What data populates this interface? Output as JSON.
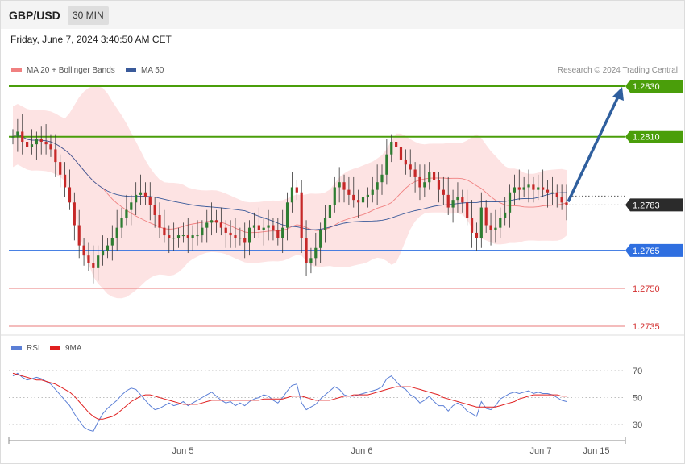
{
  "header": {
    "pair": "GBP/USD",
    "timeframe": "30 MIN",
    "datetime": "Friday, June 7, 2024 3:40:50 AM CET"
  },
  "credit": "Research © 2024 Trading Central",
  "colors": {
    "green": "#4a9e0a",
    "blue_support": "#2f6fe0",
    "red_level": "#e87a7a",
    "band_fill": "#fde3e3",
    "ma20": "#f08080",
    "ma50": "#3a5a9a",
    "arrow": "#2f5f9e",
    "candle_up": "#2e7d32",
    "candle_down": "#c62828",
    "rsi": "#5b7fd6",
    "rsi_ma": "#e02020"
  },
  "chart_data": [
    {
      "type": "candlestick",
      "legend": [
        {
          "name": "MA 20 + Bollinger Bands",
          "color": "#f08080"
        },
        {
          "name": "MA 50",
          "color": "#3a5a9a"
        }
      ],
      "ylim": [
        1.2728,
        1.2838
      ],
      "levels": [
        {
          "label": "1.2830",
          "value": 1.283,
          "style": "resistance"
        },
        {
          "label": "1.2810",
          "value": 1.281,
          "style": "resistance"
        },
        {
          "label": "1.2783",
          "value": 1.2783,
          "style": "current"
        },
        {
          "label": "1.2765",
          "value": 1.2765,
          "style": "support"
        },
        {
          "label": "1.2750",
          "value": 1.275,
          "style": "minor"
        },
        {
          "label": "1.2735",
          "value": 1.2735,
          "style": "minor"
        }
      ],
      "x_ticks": [
        "Jun 5",
        "Jun 6",
        "Jun 7",
        "Jun 15"
      ],
      "projection": {
        "from": 1.2783,
        "to": 1.283
      },
      "close": [
        1.281,
        1.2812,
        1.2808,
        1.2806,
        1.2807,
        1.2809,
        1.2808,
        1.2807,
        1.2805,
        1.28,
        1.2795,
        1.279,
        1.2784,
        1.2775,
        1.2767,
        1.2763,
        1.276,
        1.2758,
        1.2763,
        1.2765,
        1.2767,
        1.277,
        1.2774,
        1.2778,
        1.2781,
        1.2784,
        1.2787,
        1.2788,
        1.2786,
        1.2783,
        1.2779,
        1.2774,
        1.2771,
        1.277,
        1.277,
        1.2771,
        1.2771,
        1.277,
        1.2771,
        1.2771,
        1.2774,
        1.2776,
        1.2777,
        1.2776,
        1.2774,
        1.2772,
        1.2771,
        1.277,
        1.277,
        1.2768,
        1.2774,
        1.2775,
        1.2773,
        1.2774,
        1.2775,
        1.2773,
        1.277,
        1.2774,
        1.2784,
        1.279,
        1.2788,
        1.277,
        1.276,
        1.2762,
        1.2766,
        1.2773,
        1.2778,
        1.2783,
        1.279,
        1.2792,
        1.2789,
        1.2787,
        1.2785,
        1.2784,
        1.2786,
        1.2787,
        1.2789,
        1.2792,
        1.2795,
        1.2803,
        1.2808,
        1.2806,
        1.2801,
        1.2799,
        1.2797,
        1.2794,
        1.279,
        1.2792,
        1.2796,
        1.2793,
        1.2789,
        1.2787,
        1.2782,
        1.2785,
        1.2786,
        1.2784,
        1.2778,
        1.2772,
        1.277,
        1.2782,
        1.2775,
        1.2773,
        1.2774,
        1.2778,
        1.278,
        1.2788,
        1.279,
        1.2789,
        1.279,
        1.2791,
        1.2789,
        1.279,
        1.2789,
        1.2788,
        1.2788,
        1.2786,
        1.2784,
        1.2783
      ]
    },
    {
      "type": "line",
      "series": [
        {
          "name": "RSI",
          "color": "#5b7fd6"
        },
        {
          "name": "9MA",
          "color": "#e02020"
        }
      ],
      "ylim": [
        20,
        80
      ],
      "y_ticks": [
        70,
        50,
        30
      ],
      "rsi": [
        66,
        68,
        65,
        63,
        64,
        65,
        64,
        62,
        60,
        56,
        52,
        48,
        44,
        38,
        33,
        28,
        26,
        25,
        32,
        38,
        42,
        45,
        48,
        52,
        55,
        57,
        56,
        52,
        48,
        44,
        41,
        42,
        44,
        46,
        44,
        45,
        47,
        44,
        46,
        48,
        50,
        52,
        54,
        51,
        48,
        46,
        47,
        44,
        46,
        44,
        47,
        49,
        50,
        52,
        51,
        48,
        46,
        50,
        55,
        59,
        60,
        46,
        41,
        43,
        45,
        49,
        52,
        55,
        58,
        56,
        52,
        51,
        51,
        52,
        53,
        54,
        55,
        56,
        58,
        64,
        66,
        62,
        58,
        56,
        52,
        50,
        46,
        48,
        51,
        47,
        44,
        44,
        40,
        44,
        46,
        44,
        40,
        38,
        36,
        47,
        42,
        41,
        44,
        49,
        51,
        53,
        54,
        53,
        54,
        55,
        53,
        54,
        53,
        53,
        52,
        50,
        48,
        47
      ],
      "rsi_ma": [
        68,
        67,
        66,
        65,
        64,
        63,
        63,
        62,
        61,
        60,
        58,
        56,
        54,
        51,
        47,
        43,
        39,
        36,
        34,
        34,
        35,
        36,
        38,
        41,
        44,
        47,
        49,
        51,
        52,
        52,
        51,
        50,
        49,
        48,
        47,
        46,
        45,
        45,
        45,
        45,
        46,
        47,
        48,
        48,
        48,
        48,
        48,
        48,
        48,
        48,
        48,
        48,
        48,
        49,
        49,
        49,
        49,
        49,
        50,
        51,
        51,
        51,
        50,
        49,
        48,
        48,
        48,
        48,
        49,
        50,
        51,
        51,
        52,
        52,
        52,
        52,
        53,
        54,
        55,
        56,
        57,
        58,
        58,
        58,
        58,
        57,
        56,
        55,
        54,
        53,
        52,
        50,
        49,
        48,
        47,
        46,
        45,
        44,
        43,
        43,
        43,
        43,
        43,
        44,
        45,
        46,
        47,
        49,
        50,
        51,
        52,
        52,
        52,
        52,
        52,
        52,
        51,
        51
      ]
    }
  ]
}
